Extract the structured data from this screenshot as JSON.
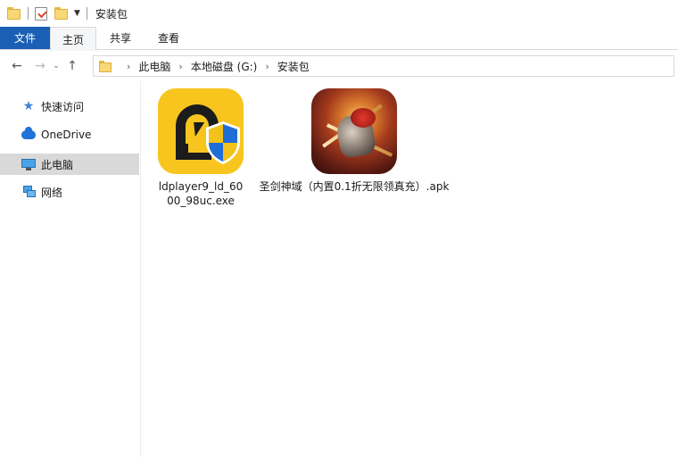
{
  "window": {
    "title": "安装包"
  },
  "ribbon": {
    "tabs": [
      {
        "label": "文件"
      },
      {
        "label": "主页"
      },
      {
        "label": "共享"
      },
      {
        "label": "查看"
      }
    ]
  },
  "address": {
    "crumbs": [
      "此电脑",
      "本地磁盘 (G:)",
      "安装包"
    ]
  },
  "sidebar": {
    "items": [
      {
        "label": "快速访问",
        "icon": "star-icon"
      },
      {
        "label": "OneDrive",
        "icon": "cloud-icon"
      },
      {
        "label": "此电脑",
        "icon": "computer-icon",
        "selected": true
      },
      {
        "label": "网络",
        "icon": "network-icon"
      }
    ]
  },
  "files": [
    {
      "name_line1": "ldplayer9_ld_60",
      "name_line2": "00_98uc.exe",
      "icon": "ldplayer-app-icon"
    },
    {
      "name_line1": "圣剑神域（内置0.1折无限领真充）.apk",
      "icon": "game-app-icon"
    }
  ],
  "colors": {
    "file_tab": "#1a5fb4",
    "selected_nav": "#d9d9d9",
    "ld_yellow": "#f7c51e"
  }
}
